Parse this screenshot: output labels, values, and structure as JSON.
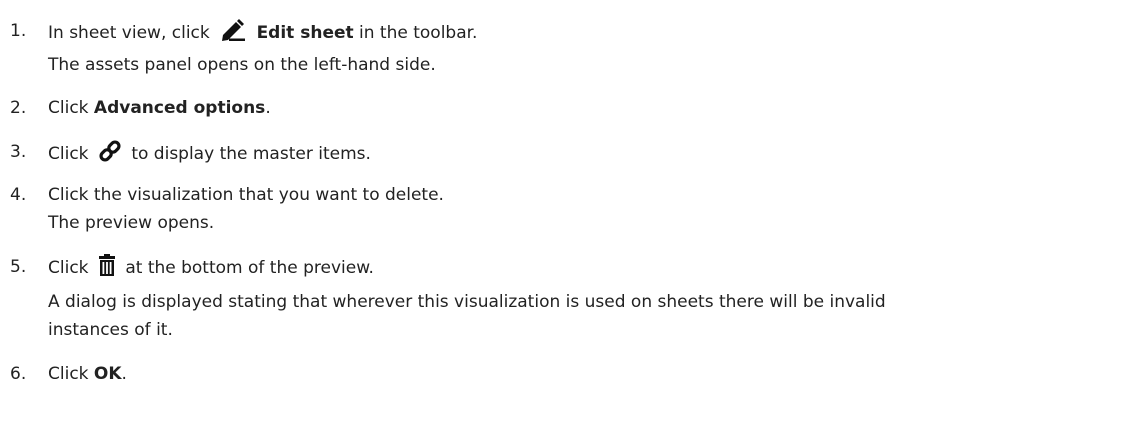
{
  "steps": [
    {
      "number": "1.",
      "pre": "In sheet view, click",
      "icon": "pencil-icon",
      "bold": "Edit sheet",
      "post": " in the toolbar.",
      "result": "The assets panel opens on the left-hand side."
    },
    {
      "number": "2.",
      "pre": "Click ",
      "bold": "Advanced options",
      "post": "."
    },
    {
      "number": "3.",
      "pre": "Click",
      "icon": "link-icon",
      "post": "to display the master items."
    },
    {
      "number": "4.",
      "text": "Click the visualization that you want to delete.",
      "result": "The preview opens."
    },
    {
      "number": "5.",
      "pre": "Click",
      "icon": "trash-icon",
      "post": "at the bottom of the preview.",
      "result_line1": "A dialog is displayed stating that wherever this visualization is used on sheets there will be invalid",
      "result_line2": "instances of it."
    },
    {
      "number": "6.",
      "pre": "Click ",
      "bold": "OK",
      "post": "."
    }
  ]
}
